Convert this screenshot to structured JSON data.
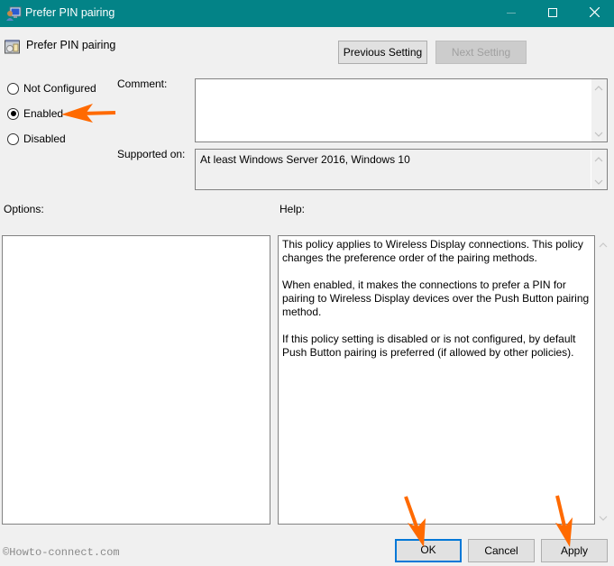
{
  "window": {
    "title": "Prefer PIN pairing",
    "controls": {
      "minimize": "minimize-icon",
      "maximize": "maximize-icon",
      "close": "close-icon"
    },
    "accent": "#038387"
  },
  "header": {
    "title": "Prefer PIN pairing",
    "previous_label": "Previous Setting",
    "next_label": "Next Setting",
    "next_disabled": true
  },
  "state": {
    "options": [
      {
        "label": "Not Configured",
        "checked": false
      },
      {
        "label": "Enabled",
        "checked": true
      },
      {
        "label": "Disabled",
        "checked": false
      }
    ]
  },
  "comment": {
    "label": "Comment:",
    "value": ""
  },
  "supported": {
    "label": "Supported on:",
    "value": "At least Windows Server 2016, Windows 10"
  },
  "options_pane": {
    "label": "Options:"
  },
  "help_pane": {
    "label": "Help:",
    "paragraphs": [
      "This policy applies to Wireless Display connections. This policy changes the preference order of the pairing methods.",
      "When enabled, it makes the connections to prefer a PIN for pairing to Wireless Display devices over the Push Button pairing method.",
      "If this policy setting is disabled or is not configured, by default Push Button pairing is preferred (if allowed by other policies)."
    ]
  },
  "footer": {
    "ok_label": "OK",
    "cancel_label": "Cancel",
    "apply_label": "Apply"
  },
  "annotations": {
    "arrow_color": "#ff6a00"
  },
  "watermark": "©Howto-connect.com"
}
